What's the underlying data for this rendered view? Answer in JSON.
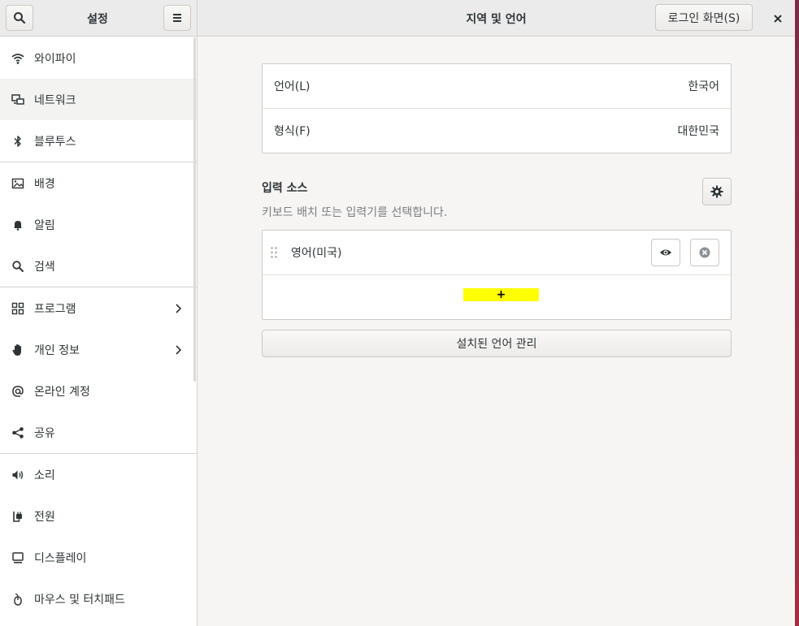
{
  "header": {
    "sidebar_title": "설정",
    "main_title": "지역 및 언어",
    "login_screen_button": "로그인 화면(S)"
  },
  "sidebar": {
    "items": [
      {
        "label": "와이파이",
        "icon": "wifi-icon"
      },
      {
        "label": "네트워크",
        "icon": "network-icon"
      },
      {
        "label": "블루투스",
        "icon": "bluetooth-icon"
      },
      {
        "label": "배경",
        "icon": "background-icon"
      },
      {
        "label": "알림",
        "icon": "bell-icon"
      },
      {
        "label": "검색",
        "icon": "search-icon"
      },
      {
        "label": "프로그램",
        "icon": "apps-grid-icon"
      },
      {
        "label": "개인 정보",
        "icon": "hand-icon"
      },
      {
        "label": "온라인 계정",
        "icon": "at-icon"
      },
      {
        "label": "공유",
        "icon": "share-icon"
      },
      {
        "label": "소리",
        "icon": "speaker-icon"
      },
      {
        "label": "전원",
        "icon": "power-icon"
      },
      {
        "label": "디스플레이",
        "icon": "display-icon"
      },
      {
        "label": "마우스 및 터치패드",
        "icon": "mouse-icon"
      }
    ]
  },
  "main": {
    "language": {
      "label": "언어(L)",
      "value": "한국어"
    },
    "formats": {
      "label": "형식(F)",
      "value": "대한민국"
    },
    "input_sources": {
      "title": "입력 소스",
      "subtitle": "키보드 배치 또는 입력기를 선택합니다.",
      "items": [
        {
          "label": "영어(미국)"
        }
      ],
      "add_symbol": "+"
    },
    "manage_languages_button": "설치된 언어 관리"
  }
}
